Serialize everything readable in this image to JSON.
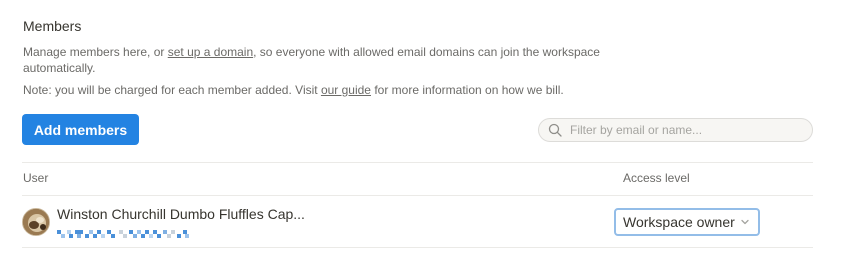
{
  "section": {
    "title": "Members",
    "desc_before": "Manage members here, or ",
    "desc_link": "set up a domain",
    "desc_after": ", so everyone with allowed email domains can join the workspace automatically.",
    "note_before": "Note: you will be charged for each member added. Visit ",
    "note_link": "our guide",
    "note_after": " for more information on how we bill."
  },
  "toolbar": {
    "add_label": "Add members",
    "search_placeholder": "Filter by email or name...",
    "search_icon": "search-icon"
  },
  "table": {
    "headers": {
      "user": "User",
      "access": "Access level"
    },
    "rows": [
      {
        "name": "Winston Churchill Dumbo Fluffles Cap...",
        "email_redacted": true,
        "access_level": "Workspace owner"
      }
    ]
  },
  "colors": {
    "accent": "#2383e2",
    "text": "#37352f",
    "muted": "#6b6a67",
    "focus_ring": "#93bde8"
  }
}
